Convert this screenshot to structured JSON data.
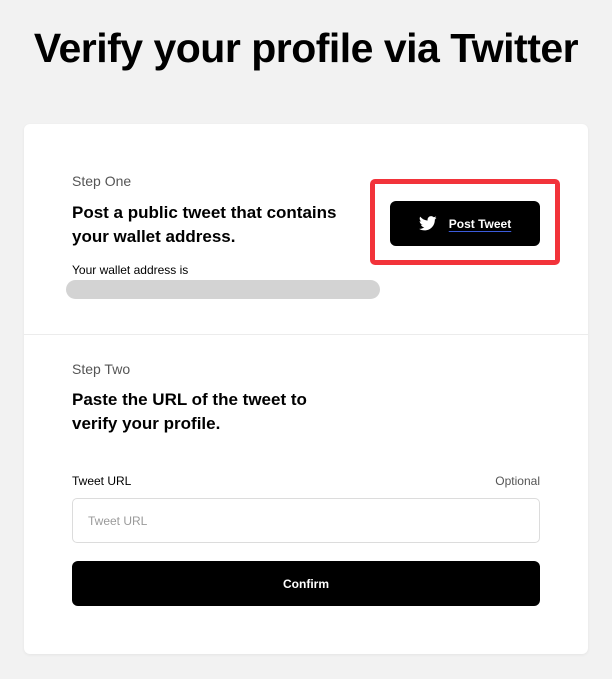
{
  "page": {
    "title": "Verify your profile via Twitter"
  },
  "step_one": {
    "label": "Step One",
    "heading": "Post a public tweet that contains your wallet address.",
    "wallet_label": "Your wallet address is",
    "wallet_address": "",
    "button_icon": "twitter-bird-icon",
    "button_label": "Post Tweet"
  },
  "step_two": {
    "label": "Step Two",
    "heading": "Paste the URL of the tweet to verify your profile.",
    "field_label": "Tweet URL",
    "optional_label": "Optional",
    "input_value": "",
    "input_placeholder": "Tweet URL",
    "confirm_label": "Confirm"
  },
  "colors": {
    "background": "#f2f2f2",
    "card": "#ffffff",
    "button": "#000000",
    "highlight": "#f2333a",
    "wallet_placeholder": "#d3d3d3"
  }
}
